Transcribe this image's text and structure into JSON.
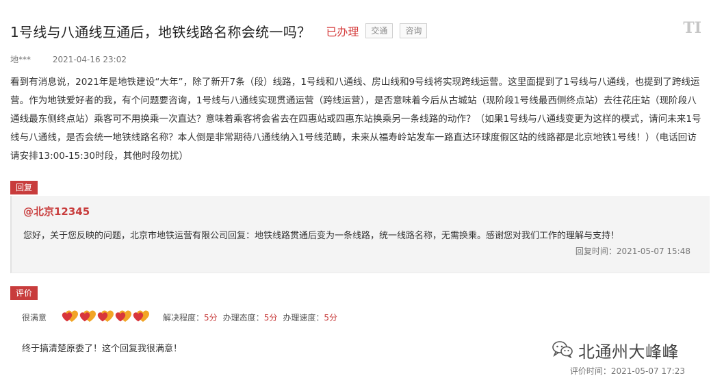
{
  "header": {
    "title": "1号线与八通线互通后，地铁线路名称会统一吗？",
    "status": "已办理",
    "tags": [
      "交通",
      "咨询"
    ],
    "font_size_button": "TI"
  },
  "meta": {
    "author": "地***",
    "date": "2021-04-16 23:02"
  },
  "body_text": "看到有消息说，2021年是地铁建设“大年”，除了新开7条（段）线路，1号线和八通线、房山线和9号线将实现跨线运营。这里面提到了1号线与八通线，也提到了跨线运营。作为地铁爱好者的我，有个问题要咨询，1号线与八通线实现贯通运营（跨线运营），是否意味着今后从古城站（现阶段1号线最西侧终点站）去往花庄站（现阶段八通线最东侧终点站）乘客可不用换乘一次直达？意味着乘客将会省去在四惠站或四惠东站换乘另一条线路的动作？（如果1号线与八通线变更为这样的模式，请问未来1号线与八通线，是否会统一地铁线路名称？本人倒是非常期待八通线纳入1号线范畴，未来从福寿岭站发车一路直达环球度假区站的线路都是北京地铁1号线！）（电话回访请安排13:00-15:30时段，其他时段勿扰）",
  "reply": {
    "badge": "回复",
    "author": "@北京12345",
    "content": "您好，关于您反映的问题，北京市地铁运营有限公司回复：地铁线路贯通后变为一条线路，统一线路名称，无需换乘。感谢您对我们工作的理解与支持！",
    "time_label": "回复时间：",
    "time": "2021-05-07 15:48"
  },
  "evaluation": {
    "badge": "评价",
    "overall": "很满意",
    "hearts": 5,
    "items": [
      {
        "label": "解决程度：",
        "value": "5分"
      },
      {
        "label": "办理态度：",
        "value": "5分"
      },
      {
        "label": "办理速度：",
        "value": "5分"
      }
    ],
    "comment": "终于搞清楚原委了！这个回复我很满意！",
    "time_label": "评价时间：",
    "time": "2021-05-07 17:23"
  },
  "watermark": {
    "icon": "wechat-icon",
    "text": "北通州大峰峰"
  },
  "colors": {
    "accent": "#c83c3c",
    "heart_back": "#f2a526",
    "heart_front": "#d8363b",
    "reply_bg": "#f4f4f4"
  }
}
